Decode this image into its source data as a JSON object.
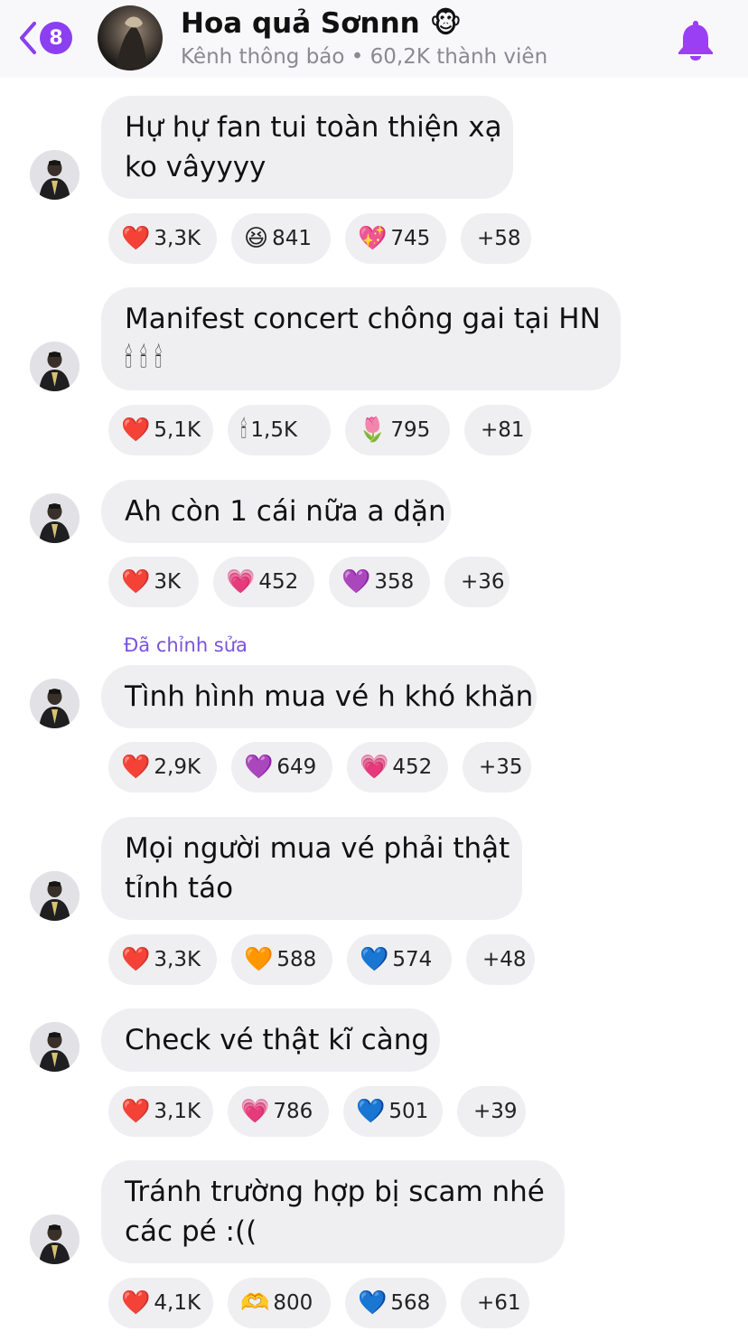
{
  "header": {
    "unread_count": "8",
    "title": "Hoa quả Sơnnn 🐵",
    "subtitle": "Kênh thông báo • 60,2K thành viên"
  },
  "colors": {
    "accent": "#8b3ff0",
    "bubble": "#efeff2",
    "edited": "#7a52e0"
  },
  "messages": [
    {
      "lines": [
        "Hự hự fan tui toàn thiện xạ",
        "ko vâyyyy"
      ],
      "edited": "",
      "reactions": [
        {
          "emoji": "❤️",
          "count": "3,3K"
        },
        {
          "emoji": "😆",
          "count": "841"
        },
        {
          "emoji": "💖",
          "count": "745"
        }
      ],
      "more": "+58"
    },
    {
      "lines": [
        "Manifest concert chông gai tại HN",
        "🕯🕯🕯"
      ],
      "edited": "",
      "reactions": [
        {
          "emoji": "❤️",
          "count": "5,1K"
        },
        {
          "emoji": "🕯",
          "count": "1,5K"
        },
        {
          "emoji": "🌷",
          "count": "795"
        }
      ],
      "more": "+81"
    },
    {
      "lines": [
        "Ah còn 1 cái nữa a dặn"
      ],
      "edited": "",
      "reactions": [
        {
          "emoji": "❤️",
          "count": "3K"
        },
        {
          "emoji": "💗",
          "count": "452"
        },
        {
          "emoji": "💜",
          "count": "358"
        }
      ],
      "more": "+36"
    },
    {
      "lines": [
        "Tình hình mua vé h khó khăn"
      ],
      "edited": "Đã chỉnh sửa",
      "reactions": [
        {
          "emoji": "❤️",
          "count": "2,9K"
        },
        {
          "emoji": "💜",
          "count": "649"
        },
        {
          "emoji": "💗",
          "count": "452"
        }
      ],
      "more": "+35"
    },
    {
      "lines": [
        "Mọi người mua vé phải thật",
        "tỉnh táo"
      ],
      "edited": "",
      "reactions": [
        {
          "emoji": "❤️",
          "count": "3,3K"
        },
        {
          "emoji": "🧡",
          "count": "588"
        },
        {
          "emoji": "💙",
          "count": "574"
        }
      ],
      "more": "+48"
    },
    {
      "lines": [
        "Check vé thật kĩ càng"
      ],
      "edited": "",
      "reactions": [
        {
          "emoji": "❤️",
          "count": "3,1K"
        },
        {
          "emoji": "💗",
          "count": "786"
        },
        {
          "emoji": "💙",
          "count": "501"
        }
      ],
      "more": "+39"
    },
    {
      "lines": [
        "Tránh trường hợp bị scam nhé",
        "các pé :(("
      ],
      "edited": "",
      "reactions": [
        {
          "emoji": "❤️",
          "count": "4,1K"
        },
        {
          "emoji": "🫶",
          "count": "800"
        },
        {
          "emoji": "💙",
          "count": "568"
        }
      ],
      "more": "+61"
    }
  ]
}
